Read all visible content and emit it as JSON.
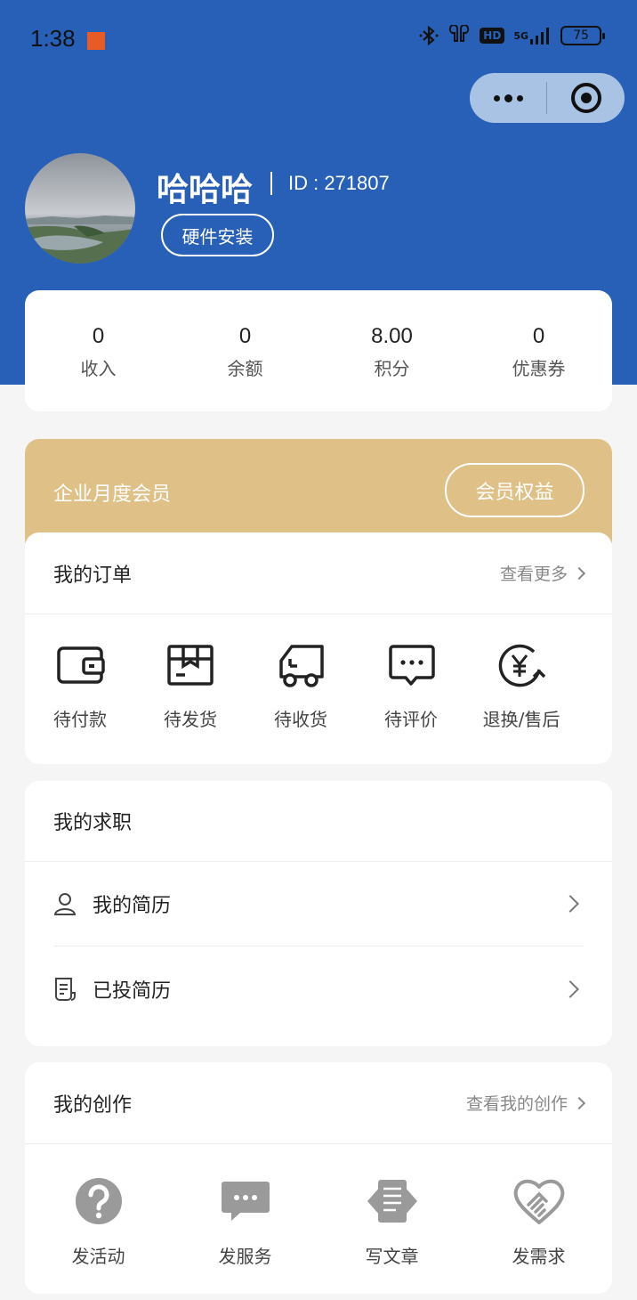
{
  "status_bar": {
    "time": "1:38",
    "network": "5G",
    "hd": "HD",
    "battery": "75"
  },
  "profile": {
    "name": "哈哈哈",
    "id_text": "ID : 271807",
    "install_button": "硬件安装"
  },
  "stats": [
    {
      "value": "0",
      "label": "收入"
    },
    {
      "value": "0",
      "label": "余额"
    },
    {
      "value": "8.00",
      "label": "积分"
    },
    {
      "value": "0",
      "label": "优惠券"
    }
  ],
  "membership": {
    "title": "企业月度会员",
    "button": "会员权益"
  },
  "orders": {
    "title": "我的订单",
    "more": "查看更多",
    "items": [
      {
        "label": "待付款",
        "icon": "wallet-icon"
      },
      {
        "label": "待发货",
        "icon": "package-icon"
      },
      {
        "label": "待收货",
        "icon": "truck-icon"
      },
      {
        "label": "待评价",
        "icon": "comment-icon"
      },
      {
        "label": "退换/售后",
        "icon": "refund-icon"
      }
    ]
  },
  "jobs": {
    "title": "我的求职",
    "items": [
      {
        "label": "我的简历",
        "icon": "user-icon"
      },
      {
        "label": "已投简历",
        "icon": "document-icon"
      }
    ]
  },
  "creations": {
    "title": "我的创作",
    "more": "查看我的创作",
    "items": [
      {
        "label": "发活动",
        "icon": "question-icon"
      },
      {
        "label": "发服务",
        "icon": "chat-icon"
      },
      {
        "label": "写文章",
        "icon": "article-icon"
      },
      {
        "label": "发需求",
        "icon": "handshake-icon"
      }
    ]
  }
}
